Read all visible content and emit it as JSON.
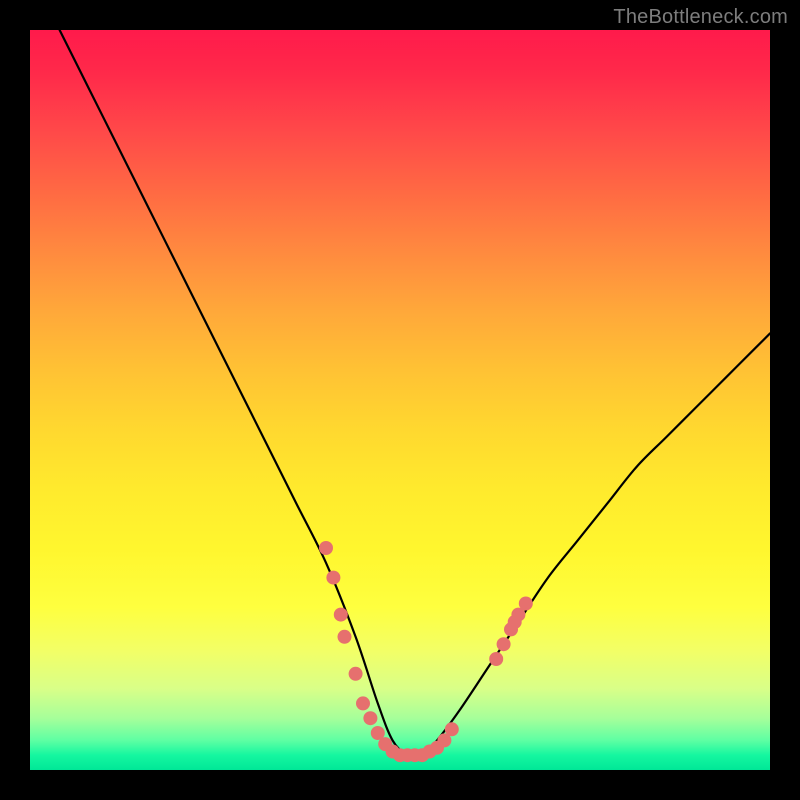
{
  "watermark": "TheBottleneck.com",
  "colors": {
    "frame": "#000000",
    "curve_stroke": "#000000",
    "marker_fill": "#e6706e",
    "gradient_top": "#ff1a4b",
    "gradient_bottom": "#00e797"
  },
  "chart_data": {
    "type": "line",
    "title": "",
    "xlabel": "",
    "ylabel": "",
    "xlim": [
      0,
      100
    ],
    "ylim": [
      0,
      100
    ],
    "grid": false,
    "legend": false,
    "note": "Axes are unlabeled; values are estimated from pixel positions on a 0–100 normalized scale where y=0 is the bottom (green) and y=100 is the top (red). Curve is a V-shaped bottleneck profile.",
    "series": [
      {
        "name": "curve",
        "x": [
          4,
          8,
          12,
          16,
          20,
          24,
          28,
          32,
          36,
          40,
          44,
          47,
          49,
          51,
          53,
          55,
          58,
          62,
          66,
          70,
          74,
          78,
          82,
          86,
          90,
          94,
          98,
          100
        ],
        "y": [
          100,
          92,
          84,
          76,
          68,
          60,
          52,
          44,
          36,
          28,
          18,
          9,
          4,
          2,
          2,
          4,
          8,
          14,
          20,
          26,
          31,
          36,
          41,
          45,
          49,
          53,
          57,
          59
        ]
      }
    ],
    "markers": {
      "name": "highlighted-points",
      "note": "Salmon dots clustered near the curve minimum and along the lower flanks.",
      "points": [
        {
          "x": 40,
          "y": 30
        },
        {
          "x": 41,
          "y": 26
        },
        {
          "x": 42,
          "y": 21
        },
        {
          "x": 42.5,
          "y": 18
        },
        {
          "x": 44,
          "y": 13
        },
        {
          "x": 45,
          "y": 9
        },
        {
          "x": 46,
          "y": 7
        },
        {
          "x": 47,
          "y": 5
        },
        {
          "x": 48,
          "y": 3.5
        },
        {
          "x": 49,
          "y": 2.5
        },
        {
          "x": 50,
          "y": 2
        },
        {
          "x": 51,
          "y": 2
        },
        {
          "x": 52,
          "y": 2
        },
        {
          "x": 53,
          "y": 2
        },
        {
          "x": 54,
          "y": 2.5
        },
        {
          "x": 55,
          "y": 3
        },
        {
          "x": 56,
          "y": 4
        },
        {
          "x": 57,
          "y": 5.5
        },
        {
          "x": 63,
          "y": 15
        },
        {
          "x": 64,
          "y": 17
        },
        {
          "x": 65,
          "y": 19
        },
        {
          "x": 65.5,
          "y": 20
        },
        {
          "x": 66,
          "y": 21
        },
        {
          "x": 67,
          "y": 22.5
        }
      ]
    }
  }
}
